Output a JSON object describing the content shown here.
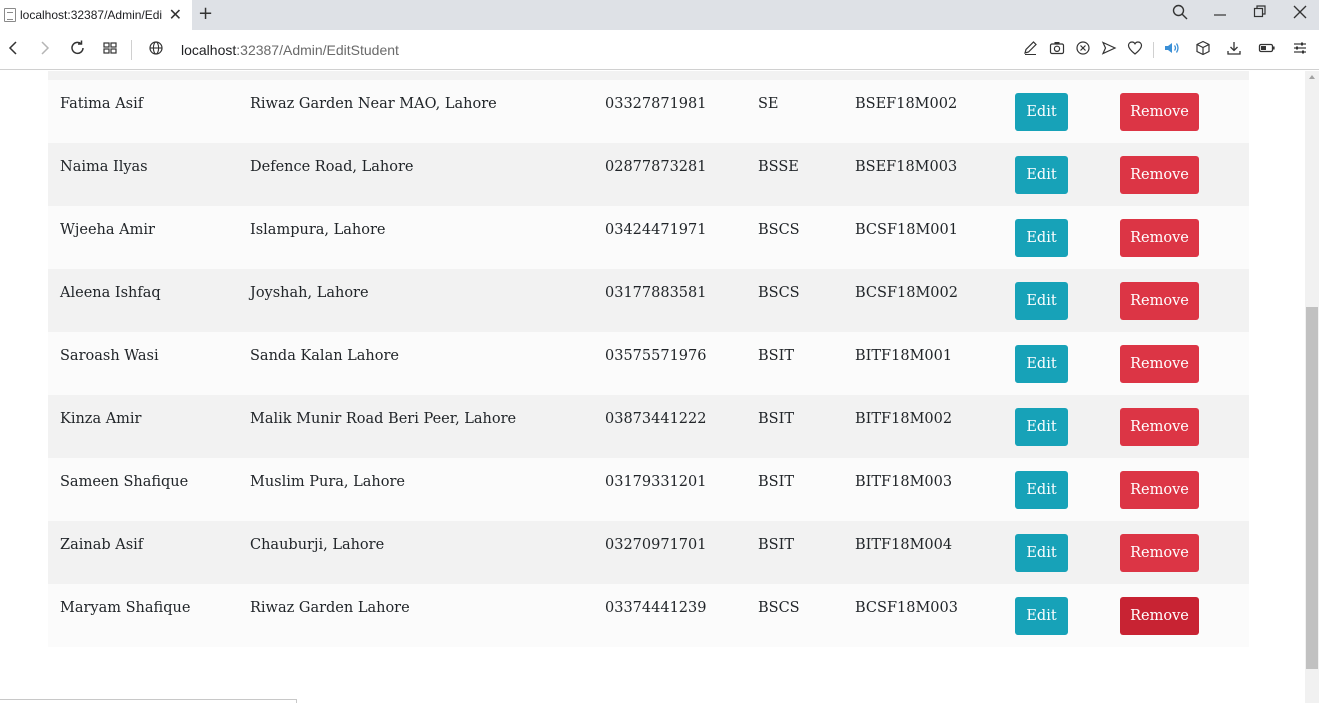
{
  "browser": {
    "tab_title": "localhost:32387/Admin/Edi",
    "url_host": "localhost",
    "url_rest": ":32387/Admin/EditStudent"
  },
  "icons": {
    "tab_favicon": "page-icon",
    "tab_close": "close-icon",
    "new_tab": "plus-icon",
    "search": "search-icon",
    "minimize": "minimize-icon",
    "restore": "restore-icon",
    "close_window": "close-icon",
    "back": "back-arrow-icon",
    "forward": "forward-arrow-icon",
    "reload": "reload-icon",
    "tab_grid": "tab-grid-icon",
    "site_info": "globe-icon",
    "edit_page": "edit-icon",
    "screenshot": "camera-icon",
    "block": "block-icon",
    "send": "send-icon",
    "favorites": "heart-icon",
    "audio": "speaker-icon",
    "extensions": "cube-icon",
    "downloads": "download-icon",
    "battery": "battery-icon",
    "settings": "sliders-icon"
  },
  "colors": {
    "edit_button": "#17a2b8",
    "remove_button": "#dc3545",
    "remove_button_active": "#c82333",
    "row_even": "#f2f2f2",
    "row_odd": "#fbfbfb"
  },
  "students": [
    {
      "name": "Fatima Asif",
      "address": "Riwaz Garden Near MAO, Lahore",
      "phone": "03327871981",
      "program": "SE",
      "roll": "BSEF18M002",
      "edit_label": "Edit",
      "remove_label": "Remove"
    },
    {
      "name": "Naima Ilyas",
      "address": "Defence Road, Lahore",
      "phone": "02877873281",
      "program": "BSSE",
      "roll": "BSEF18M003",
      "edit_label": "Edit",
      "remove_label": "Remove"
    },
    {
      "name": "Wjeeha Amir",
      "address": "Islampura, Lahore",
      "phone": "03424471971",
      "program": "BSCS",
      "roll": "BCSF18M001",
      "edit_label": "Edit",
      "remove_label": "Remove"
    },
    {
      "name": "Aleena Ishfaq",
      "address": "Joyshah, Lahore",
      "phone": "03177883581",
      "program": "BSCS",
      "roll": "BCSF18M002",
      "edit_label": "Edit",
      "remove_label": "Remove"
    },
    {
      "name": "Saroash Wasi",
      "address": "Sanda Kalan Lahore",
      "phone": "03575571976",
      "program": "BSIT",
      "roll": "BITF18M001",
      "edit_label": "Edit",
      "remove_label": "Remove"
    },
    {
      "name": "Kinza Amir",
      "address": "Malik Munir Road Beri Peer, Lahore",
      "phone": "03873441222",
      "program": "BSIT",
      "roll": "BITF18M002",
      "edit_label": "Edit",
      "remove_label": "Remove"
    },
    {
      "name": "Sameen Shafique",
      "address": "Muslim Pura, Lahore",
      "phone": "03179331201",
      "program": "BSIT",
      "roll": "BITF18M003",
      "edit_label": "Edit",
      "remove_label": "Remove"
    },
    {
      "name": "Zainab Asif",
      "address": "Chauburji, Lahore",
      "phone": "03270971701",
      "program": "BSIT",
      "roll": "BITF18M004",
      "edit_label": "Edit",
      "remove_label": "Remove"
    },
    {
      "name": "Maryam Shafique",
      "address": "Riwaz Garden Lahore",
      "phone": "03374441239",
      "program": "BSCS",
      "roll": "BCSF18M003",
      "edit_label": "Edit",
      "remove_label": "Remove"
    }
  ]
}
